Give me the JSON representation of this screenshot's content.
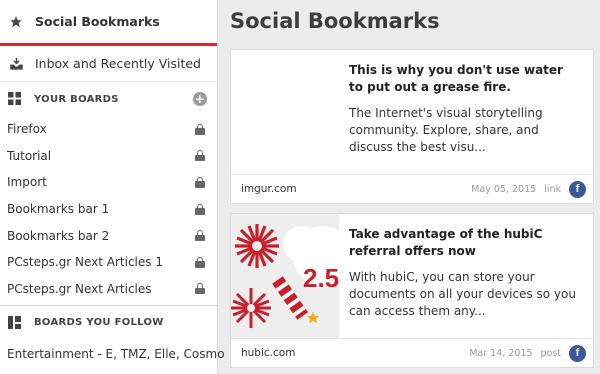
{
  "sidebar": {
    "active_item": {
      "label": "Social Bookmarks",
      "icon": "star-icon"
    },
    "inbox_item": {
      "label": "Inbox and Recently Visited",
      "icon": "inbox-icon"
    },
    "your_boards": {
      "heading": "YOUR BOARDS",
      "items": [
        {
          "label": "Firefox",
          "private": true
        },
        {
          "label": "Tutorial",
          "private": true
        },
        {
          "label": "Import",
          "private": true
        },
        {
          "label": "Bookmarks bar 1",
          "private": true
        },
        {
          "label": "Bookmarks bar 2",
          "private": true
        },
        {
          "label": "PCsteps.gr Next Articles 1",
          "private": true
        },
        {
          "label": "PCsteps.gr Next Articles",
          "private": true
        }
      ]
    },
    "boards_you_follow": {
      "heading": "BOARDS YOU FOLLOW",
      "items": [
        {
          "label": "Entertainment - E, TMZ, Elle, Cosmo"
        }
      ]
    }
  },
  "main": {
    "title": "Social Bookmarks",
    "cards": [
      {
        "title": "This is why you don't use water to put out a grease fire.",
        "description": "The Internet's visual storytelling community. Explore, share, and discuss the best visu...",
        "domain": "imgur.com",
        "date": "May 05, 2015",
        "kind": "link",
        "share_icon": "facebook-icon"
      },
      {
        "title": "Take advantage of the hubiC referral offers now",
        "description": "With hubiC, you can store your documents on all your devices so you can access them any...",
        "domain": "hubic.com",
        "date": "Mar 14, 2015",
        "kind": "post",
        "share_icon": "facebook-icon",
        "thumb_text": "2.5"
      }
    ]
  },
  "colors": {
    "accent": "#e0242d",
    "facebook": "#3b5998",
    "background": "#ececec"
  }
}
